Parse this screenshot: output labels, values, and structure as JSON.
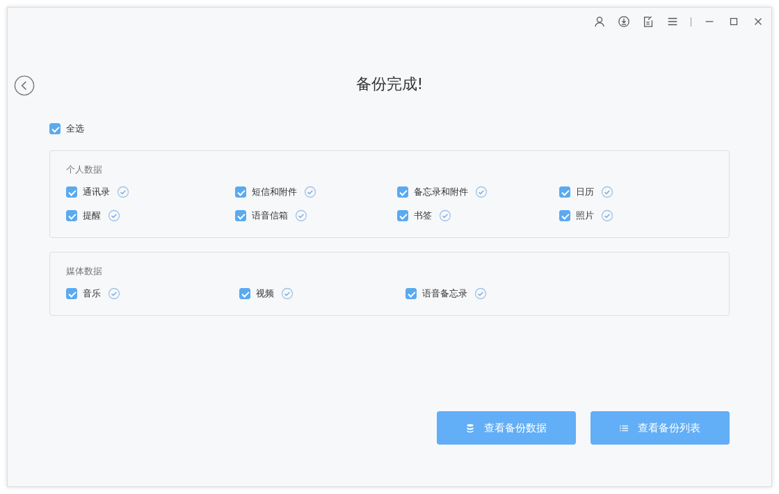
{
  "title": "备份完成!",
  "select_all": {
    "label": "全选",
    "checked": true
  },
  "groups": [
    {
      "title": "个人数据",
      "items": [
        {
          "label": "通讯录",
          "checked": true,
          "done": true
        },
        {
          "label": "短信和附件",
          "checked": true,
          "done": true
        },
        {
          "label": "备忘录和附件",
          "checked": true,
          "done": true
        },
        {
          "label": "日历",
          "checked": true,
          "done": true
        },
        {
          "label": "提醒",
          "checked": true,
          "done": true
        },
        {
          "label": "语音信箱",
          "checked": true,
          "done": true
        },
        {
          "label": "书签",
          "checked": true,
          "done": true
        },
        {
          "label": "照片",
          "checked": true,
          "done": true
        }
      ]
    },
    {
      "title": "媒体数据",
      "items": [
        {
          "label": "音乐",
          "checked": true,
          "done": true
        },
        {
          "label": "视频",
          "checked": true,
          "done": true
        },
        {
          "label": "语音备忘录",
          "checked": true,
          "done": true
        }
      ]
    }
  ],
  "buttons": [
    {
      "label": "查看备份数据",
      "kind": "data"
    },
    {
      "label": "查看备份列表",
      "kind": "list"
    }
  ]
}
